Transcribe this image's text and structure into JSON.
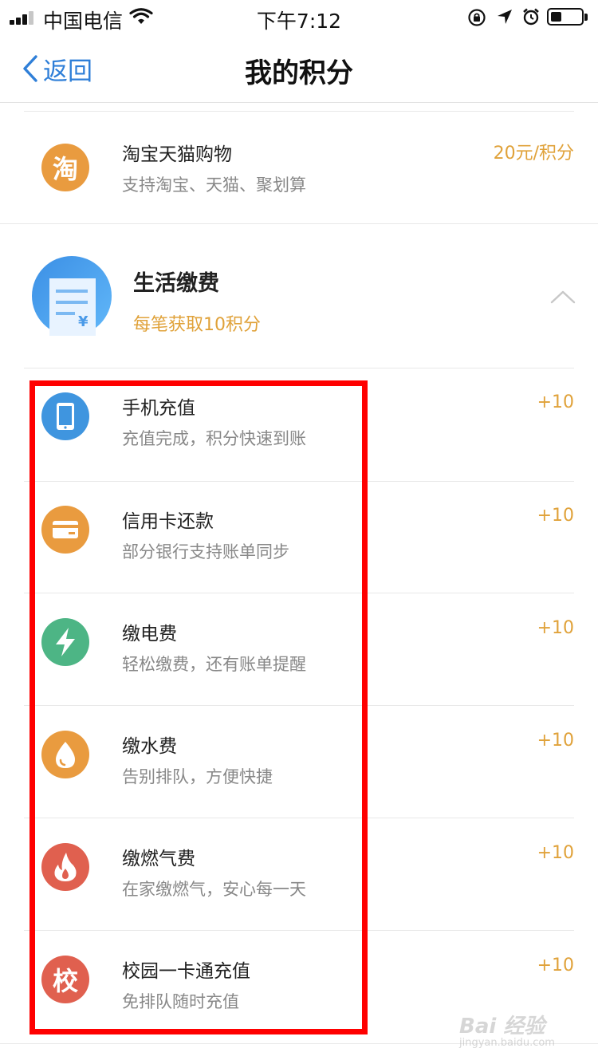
{
  "status_bar": {
    "carrier": "中国电信",
    "time": "下午7:12",
    "battery_level": 0.35
  },
  "nav": {
    "back_label": "返回",
    "title": "我的积分"
  },
  "top_item": {
    "title": "淘宝天猫购物",
    "subtitle": "支持淘宝、天猫、聚划算",
    "points": "20元/积分",
    "icon_glyph": "淘",
    "icon_color": "#e99b3f"
  },
  "category": {
    "title": "生活缴费",
    "subtitle": "每笔获取10积分"
  },
  "items": [
    {
      "title": "手机充值",
      "subtitle": "充值完成，积分快速到账",
      "points": "+10",
      "icon": "phone-icon",
      "color": "#3f95df"
    },
    {
      "title": "信用卡还款",
      "subtitle": "部分银行支持账单同步",
      "points": "+10",
      "icon": "credit-card-icon",
      "color": "#e99b3f"
    },
    {
      "title": "缴电费",
      "subtitle": "轻松缴费，还有账单提醒",
      "points": "+10",
      "icon": "lightning-icon",
      "color": "#4db585"
    },
    {
      "title": "缴水费",
      "subtitle": "告别排队，方便快捷",
      "points": "+10",
      "icon": "water-drop-icon",
      "color": "#e99b3f"
    },
    {
      "title": "缴燃气费",
      "subtitle": "在家缴燃气，安心每一天",
      "points": "+10",
      "icon": "flame-icon",
      "color": "#e0604f"
    },
    {
      "title": "校园一卡通充值",
      "subtitle": "免排队随时充值",
      "points": "+10",
      "icon": "campus-card-icon",
      "icon_glyph": "校",
      "color": "#e0604f"
    }
  ],
  "watermark": {
    "line1": "Bai 经验",
    "line2": "jingyan.baidu.com"
  },
  "colors": {
    "accent_blue": "#2f7fd8",
    "points_orange": "#e0a23a",
    "highlight_red": "#ff0000"
  }
}
